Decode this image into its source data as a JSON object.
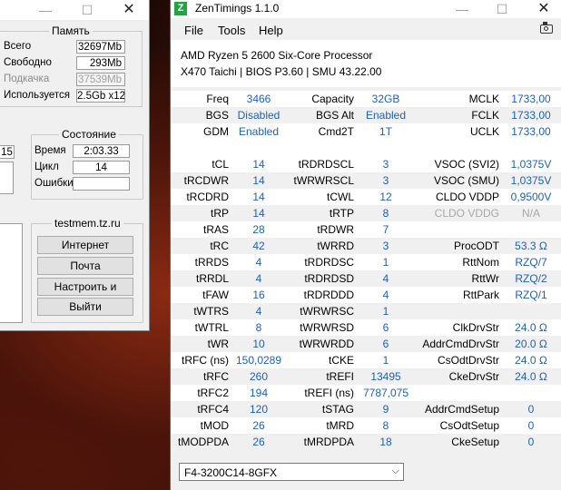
{
  "tm5": {
    "title_min": "—",
    "title_max": "☐",
    "title_close": "✕",
    "memory": {
      "title": "Память",
      "rows": [
        {
          "label": "Всего",
          "value": "32697Mb",
          "dim": false
        },
        {
          "label": "Свободно",
          "value": "293Mb",
          "dim": false
        },
        {
          "label": "Подкачка",
          "value": "37539Mb",
          "dim": true
        },
        {
          "label": "Используется",
          "value": "2.5Gb x12",
          "dim": false
        }
      ]
    },
    "state": {
      "title": "Состояние",
      "left_fragment": "15",
      "rows": [
        {
          "label": "Время",
          "value": "2:03.33"
        },
        {
          "label": "Цикл",
          "value": "14"
        },
        {
          "label": "Ошибки",
          "value": ""
        }
      ]
    },
    "links": {
      "title": "testmem.tz.ru",
      "buttons": [
        "Интернет",
        "Почта",
        "Настроить и выйти",
        "Выйти"
      ]
    }
  },
  "zen": {
    "title": "ZenTimings 1.1.0",
    "logo": "Z",
    "title_min": "—",
    "title_max": "☐",
    "title_close": "✕",
    "menu": [
      "File",
      "Tools",
      "Help"
    ],
    "cpu": "AMD Ryzen 5 2600 Six-Core Processor",
    "board": "X470 Taichi | BIOS P3.60 | SMU 43.22.00",
    "rows": [
      [
        {
          "k": "Freq",
          "v": "3466"
        },
        {
          "k": "Capacity",
          "v": "32GB"
        },
        {
          "k": "MCLK",
          "v": "1733,00"
        }
      ],
      [
        {
          "k": "BGS",
          "v": "Disabled"
        },
        {
          "k": "BGS Alt",
          "v": "Enabled"
        },
        {
          "k": "FCLK",
          "v": "1733,00"
        }
      ],
      [
        {
          "k": "GDM",
          "v": "Enabled"
        },
        {
          "k": "Cmd2T",
          "v": "1T"
        },
        {
          "k": "UCLK",
          "v": "1733,00"
        }
      ],
      [],
      [
        {
          "k": "tCL",
          "v": "14"
        },
        {
          "k": "tRDRDSCL",
          "v": "3"
        },
        {
          "k": "VSOC (SVI2)",
          "v": "1,0375V"
        }
      ],
      [
        {
          "k": "tRCDWR",
          "v": "14"
        },
        {
          "k": "tWRWRSCL",
          "v": "3"
        },
        {
          "k": "VSOC (SMU)",
          "v": "1,0375V"
        }
      ],
      [
        {
          "k": "tRCDRD",
          "v": "14"
        },
        {
          "k": "tCWL",
          "v": "12"
        },
        {
          "k": "CLDO VDDP",
          "v": "0,9500V"
        }
      ],
      [
        {
          "k": "tRP",
          "v": "14"
        },
        {
          "k": "tRTP",
          "v": "8"
        },
        {
          "k": "CLDO VDDG",
          "v": "N/A",
          "dis": true
        }
      ],
      [
        {
          "k": "tRAS",
          "v": "28"
        },
        {
          "k": "tRDWR",
          "v": "7"
        },
        {
          "k": "",
          "v": ""
        }
      ],
      [
        {
          "k": "tRC",
          "v": "42"
        },
        {
          "k": "tWRRD",
          "v": "3"
        },
        {
          "k": "ProcODT",
          "v": "53.3 Ω"
        }
      ],
      [
        {
          "k": "tRRDS",
          "v": "4"
        },
        {
          "k": "tRDRDSC",
          "v": "1"
        },
        {
          "k": "RttNom",
          "v": "RZQ/7"
        }
      ],
      [
        {
          "k": "tRRDL",
          "v": "4"
        },
        {
          "k": "tRDRDSD",
          "v": "4"
        },
        {
          "k": "RttWr",
          "v": "RZQ/2"
        }
      ],
      [
        {
          "k": "tFAW",
          "v": "16"
        },
        {
          "k": "tRDRDDD",
          "v": "4"
        },
        {
          "k": "RttPark",
          "v": "RZQ/1"
        }
      ],
      [
        {
          "k": "tWTRS",
          "v": "4"
        },
        {
          "k": "tWRWRSC",
          "v": "1"
        },
        {
          "k": "",
          "v": ""
        }
      ],
      [
        {
          "k": "tWTRL",
          "v": "8"
        },
        {
          "k": "tWRWRSD",
          "v": "6"
        },
        {
          "k": "ClkDrvStr",
          "v": "24.0 Ω"
        }
      ],
      [
        {
          "k": "tWR",
          "v": "10"
        },
        {
          "k": "tWRWRDD",
          "v": "6"
        },
        {
          "k": "AddrCmdDrvStr",
          "v": "20.0 Ω"
        }
      ],
      [
        {
          "k": "tRFC (ns)",
          "v": "150,0289"
        },
        {
          "k": "tCKE",
          "v": "1"
        },
        {
          "k": "CsOdtDrvStr",
          "v": "24.0 Ω"
        }
      ],
      [
        {
          "k": "tRFC",
          "v": "260"
        },
        {
          "k": "tREFI",
          "v": "13495"
        },
        {
          "k": "CkeDrvStr",
          "v": "24.0 Ω"
        }
      ],
      [
        {
          "k": "tRFC2",
          "v": "194"
        },
        {
          "k": "tREFI (ns)",
          "v": "7787,075"
        },
        {
          "k": "",
          "v": ""
        }
      ],
      [
        {
          "k": "tRFC4",
          "v": "120"
        },
        {
          "k": "tSTAG",
          "v": "9"
        },
        {
          "k": "AddrCmdSetup",
          "v": "0"
        }
      ],
      [
        {
          "k": "tMOD",
          "v": "26"
        },
        {
          "k": "tMRD",
          "v": "8"
        },
        {
          "k": "CsOdtSetup",
          "v": "0"
        }
      ],
      [
        {
          "k": "tMODPDA",
          "v": "26"
        },
        {
          "k": "tMRDPDA",
          "v": "18"
        },
        {
          "k": "CkeSetup",
          "v": "0"
        }
      ]
    ],
    "dimm_select": "F4-3200C14-8GFX"
  },
  "colors": {
    "value_blue": "#1f5fbf",
    "disabled_gray": "#a8a8a8",
    "zen_logo": "#25a244"
  }
}
